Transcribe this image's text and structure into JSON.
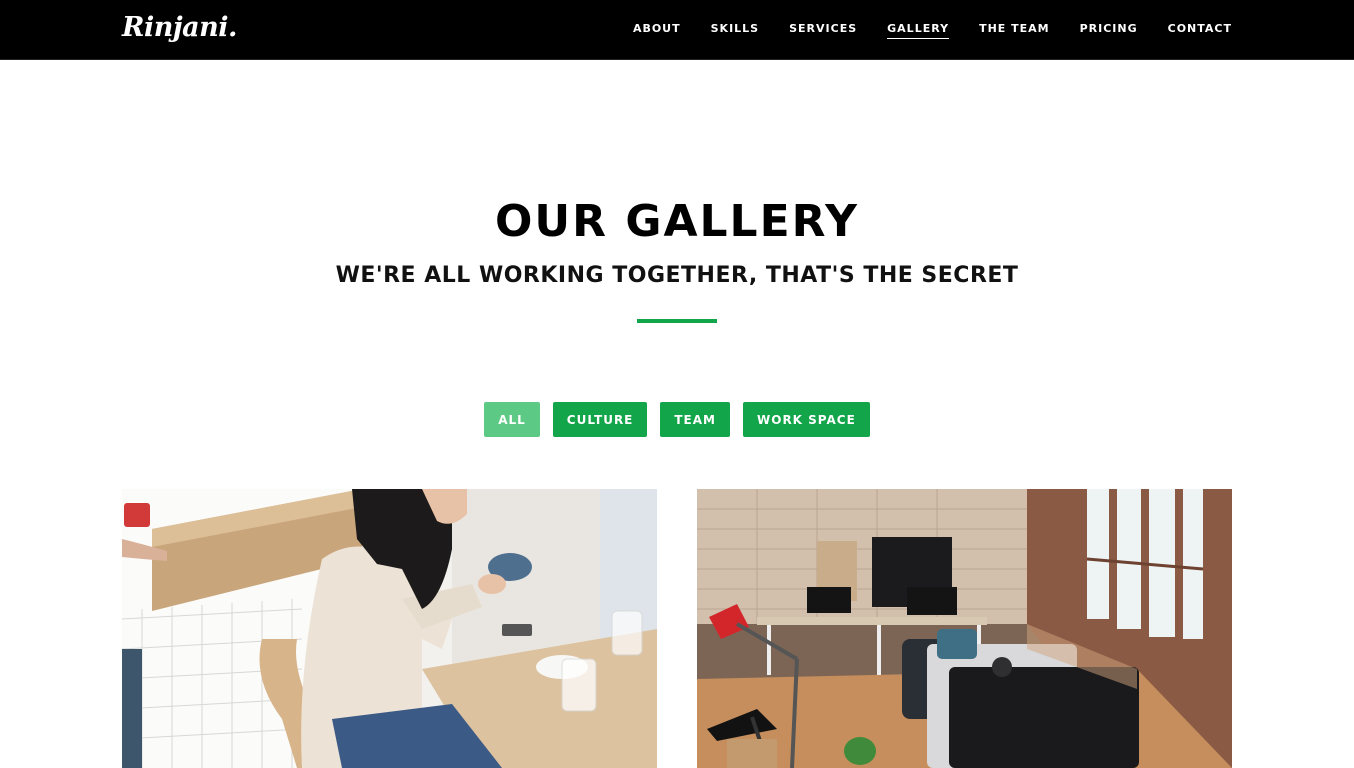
{
  "brand": {
    "logo_text": "Rinjani."
  },
  "nav": {
    "items": [
      {
        "label": "ABOUT",
        "active": false
      },
      {
        "label": "SKILLS",
        "active": false
      },
      {
        "label": "SERVICES",
        "active": false
      },
      {
        "label": "GALLERY",
        "active": true
      },
      {
        "label": "THE TEAM",
        "active": false
      },
      {
        "label": "PRICING",
        "active": false
      },
      {
        "label": "CONTACT",
        "active": false
      }
    ]
  },
  "section": {
    "title": "OUR GALLERY",
    "subtitle": "WE'RE ALL WORKING TOGETHER, THAT'S THE SECRET"
  },
  "filters": [
    {
      "label": "ALL",
      "active": true
    },
    {
      "label": "CULTURE",
      "active": false
    },
    {
      "label": "TEAM",
      "active": false
    },
    {
      "label": "WORK SPACE",
      "active": false
    }
  ],
  "gallery": [
    {
      "subject": "woman-drinking-coffee-photo"
    },
    {
      "subject": "office-workspace-photo"
    }
  ],
  "colors": {
    "accent": "#13a54a",
    "accent_active": "#5cc985",
    "nav_background": "#000000"
  }
}
